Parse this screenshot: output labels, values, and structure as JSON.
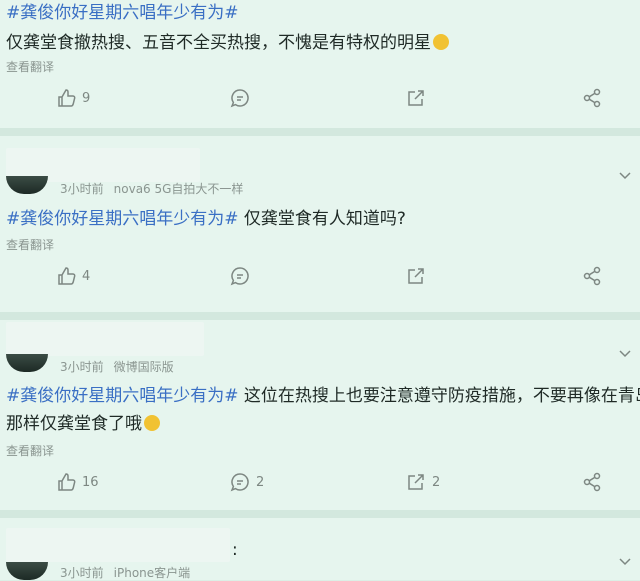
{
  "posts": [
    {
      "tag": "#龚俊你好星期六唱年少有为#",
      "text": "仅龚堂食撤热搜、五音不全买热搜，不愧是有特权的明星",
      "translate": "查看翻译",
      "like_count": "9",
      "comment_count": "",
      "repost_count": ""
    },
    {
      "time": "3小时前",
      "device": "nova6 5G自拍大不一样",
      "tag": "#龚俊你好星期六唱年少有为#",
      "text": " 仅龚堂食有人知道吗?",
      "translate": "查看翻译",
      "like_count": "4",
      "comment_count": "",
      "repost_count": ""
    },
    {
      "time": "3小时前",
      "device": "微博国际版",
      "tag": "#龚俊你好星期六唱年少有为#",
      "text": " 这位在热搜上也要注意遵守防疫措施，不要再像在青岛",
      "text2": "那样仅龚堂食了哦",
      "translate": "查看翻译",
      "like_count": "16",
      "comment_count": "2",
      "repost_count": "2"
    },
    {
      "time": "3小时前",
      "device": "iPhone客户端",
      "colon": ":"
    }
  ],
  "icons": {
    "like": "thumbs-up-icon",
    "comment": "comment-icon",
    "repost": "repost-icon",
    "share": "share-icon",
    "more": "chevron-down-icon"
  },
  "colors": {
    "tag": "#3a6fc4",
    "background": "#dcefe6"
  }
}
